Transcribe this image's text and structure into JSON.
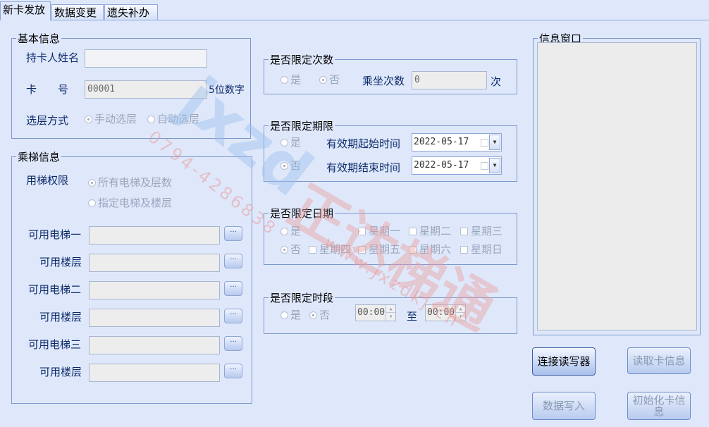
{
  "tabs": [
    "新卡发放",
    "数据变更",
    "遗失补办"
  ],
  "basic": {
    "legend": "基本信息",
    "name_label": "持卡人姓名",
    "name_value": "",
    "card_label": "卡　　号",
    "card_value": "00001",
    "card_hint": "5位数字",
    "floor_mode_label": "选层方式",
    "floor_mode_options": [
      "手动选层",
      "自动选层"
    ],
    "floor_mode_selected": "手动选层"
  },
  "elevator": {
    "legend": "乘梯信息",
    "permission_label": "用梯权限",
    "permission_options": [
      "所有电梯及层数",
      "指定电梯及楼层"
    ],
    "permission_selected": "所有电梯及层数",
    "rows": [
      {
        "label": "可用电梯一",
        "value": "",
        "button": "···"
      },
      {
        "label": "可用楼层",
        "value": "",
        "button": "···"
      },
      {
        "label": "可用电梯二",
        "value": "",
        "button": "···"
      },
      {
        "label": "可用楼层",
        "value": "",
        "button": "···"
      },
      {
        "label": "可用电梯三",
        "value": "",
        "button": "···"
      },
      {
        "label": "可用楼层",
        "value": "",
        "button": "···"
      }
    ]
  },
  "limit_count": {
    "legend": "是否限定次数",
    "yes": "是",
    "no": "否",
    "selected": "否",
    "rides_label": "乘坐次数",
    "rides_value": "0",
    "unit": "次"
  },
  "limit_period": {
    "legend": "是否限定期限",
    "yes": "是",
    "no": "否",
    "selected": "否",
    "start_label": "有效期起始时间",
    "start_value": "2022-05-17",
    "end_label": "有效期结束时间",
    "end_value": "2022-05-17"
  },
  "limit_date": {
    "legend": "是否限定日期",
    "yes": "是",
    "no": "否",
    "selected": "否",
    "days_row1": [
      "星期一",
      "星期二",
      "星期三"
    ],
    "days_row2": [
      "星期四",
      "星期五",
      "星期六",
      "星期日"
    ]
  },
  "limit_time": {
    "legend": "是否限定时段",
    "yes": "是",
    "no": "否",
    "selected": "否",
    "from_value": "00:00",
    "to_label": "至",
    "to_value": "00:00"
  },
  "info": {
    "legend": "信息窗口",
    "content": ""
  },
  "buttons": {
    "connect": "连接读写器",
    "read": "读取卡信息",
    "write": "数据写入",
    "init": "初始化卡信息"
  },
  "watermark": {
    "logo_text": "jxzd",
    "brand_text": "正达梯通",
    "phone": "0794-4286838",
    "site": "www.jxzdkj.cn"
  },
  "colors": {
    "background": "#dfe8fb",
    "border": "#7c98cc",
    "label_text": "#0b2a6a",
    "disabled_text": "#9aa6bd",
    "watermark_red": "#e8a0a0",
    "watermark_blue": "#9ec1ec"
  }
}
